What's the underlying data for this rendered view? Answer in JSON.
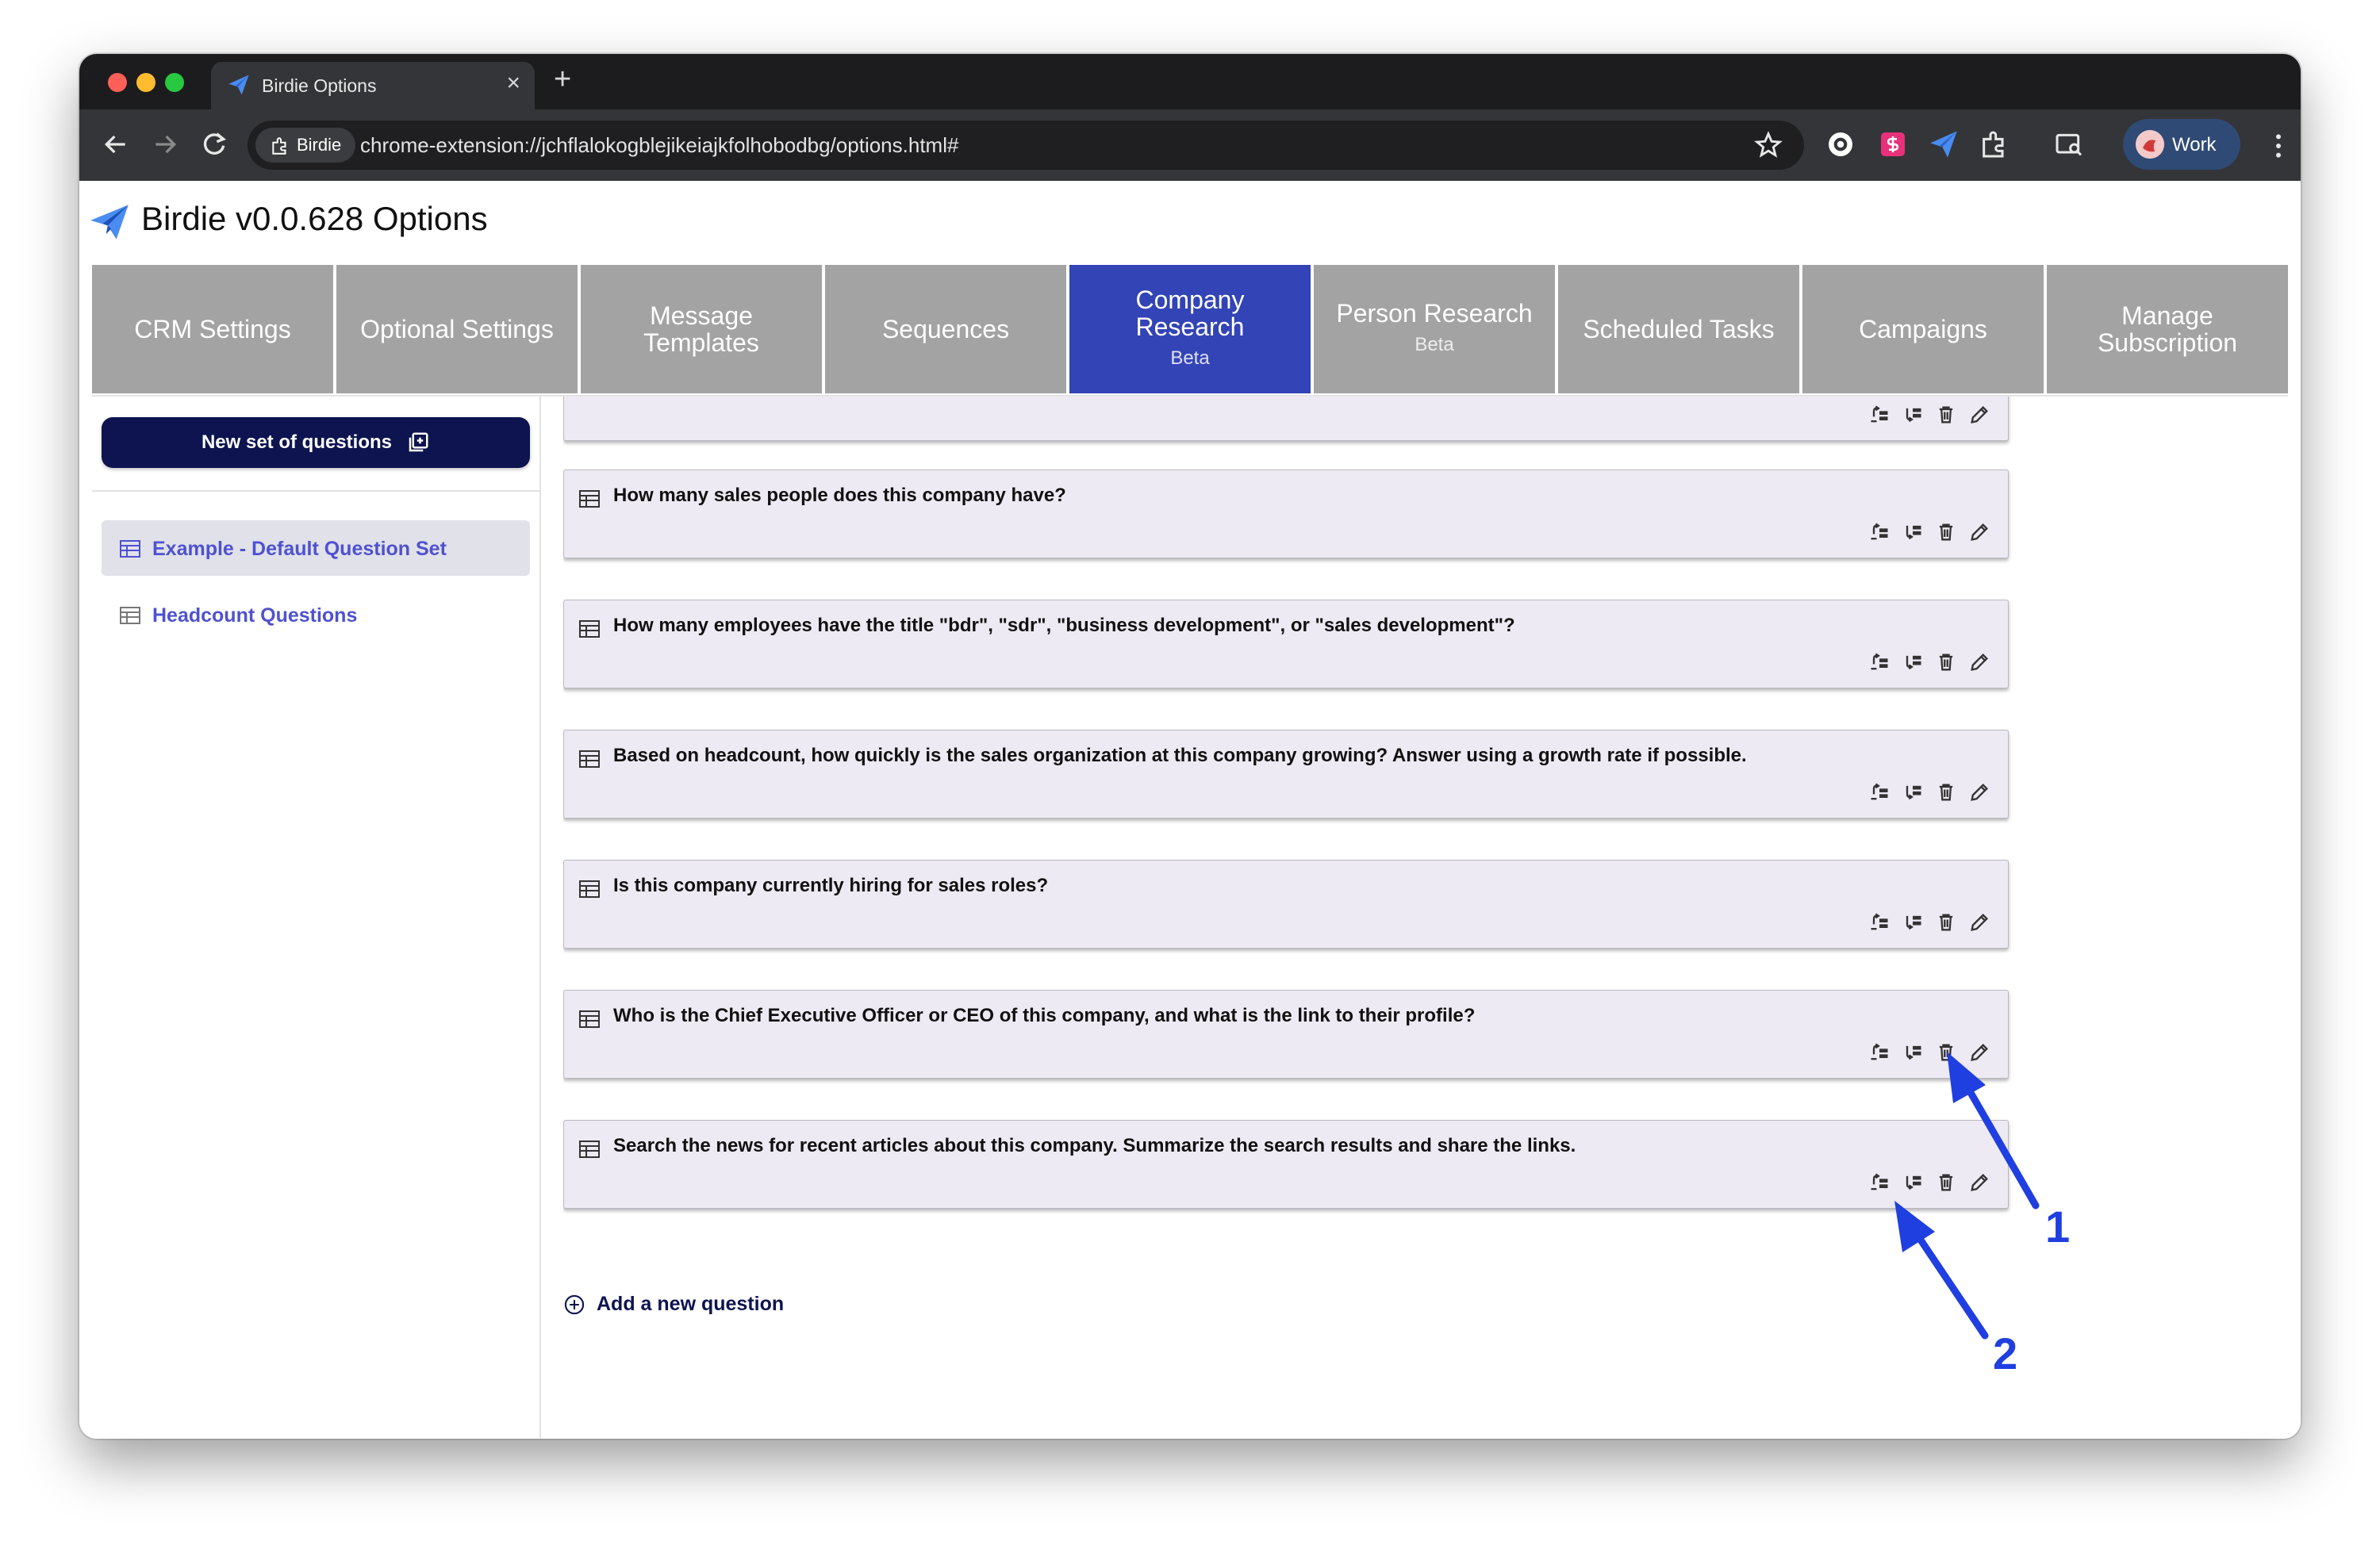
{
  "browser": {
    "tab_title": "Birdie Options",
    "site_chip": "Birdie",
    "url": "chrome-extension://jchflalokogblejikeiajkfolhobodbg/options.html#",
    "profile_label": "Work",
    "new_tab_glyph": "+",
    "close_glyph": "×"
  },
  "app": {
    "title": "Birdie v0.0.628 Options",
    "accent_color": "#3344b6",
    "dark_button_color": "#0d1450"
  },
  "nav_tabs": [
    {
      "label": "CRM Settings"
    },
    {
      "label": "Optional Settings"
    },
    {
      "label": "Message Templates"
    },
    {
      "label": "Sequences"
    },
    {
      "label": "Company Research",
      "sub": "Beta",
      "active": true
    },
    {
      "label": "Person Research",
      "sub": "Beta"
    },
    {
      "label": "Scheduled Tasks"
    },
    {
      "label": "Campaigns"
    },
    {
      "label": "Manage Subscription"
    }
  ],
  "sidebar": {
    "new_set_button": "New set of questions",
    "question_sets": [
      {
        "label": "Example - Default Question Set",
        "selected": true
      },
      {
        "label": "Headcount Questions",
        "selected": false
      }
    ]
  },
  "questions": [
    {
      "text": ""
    },
    {
      "text": "How many sales people does this company have?"
    },
    {
      "text": "How many employees have the title \"bdr\", \"sdr\", \"business development\", or \"sales development\"?"
    },
    {
      "text": "Based on headcount, how quickly is the sales organization at this company growing? Answer using a growth rate if possible."
    },
    {
      "text": "Is this company currently hiring for sales roles?"
    },
    {
      "text": "Who is the Chief Executive Officer or CEO of this company, and what is the link to their profile?"
    },
    {
      "text": "Search the news for recent articles about this company. Summarize the search results and share the links."
    }
  ],
  "question_actions": [
    "move-up-icon",
    "move-down-icon",
    "trash-icon",
    "pencil-icon"
  ],
  "add_question_label": "Add a new question",
  "annotations": [
    {
      "label": "1",
      "points_to": "trash-icon"
    },
    {
      "label": "2",
      "points_to": "move-down-icon"
    }
  ]
}
